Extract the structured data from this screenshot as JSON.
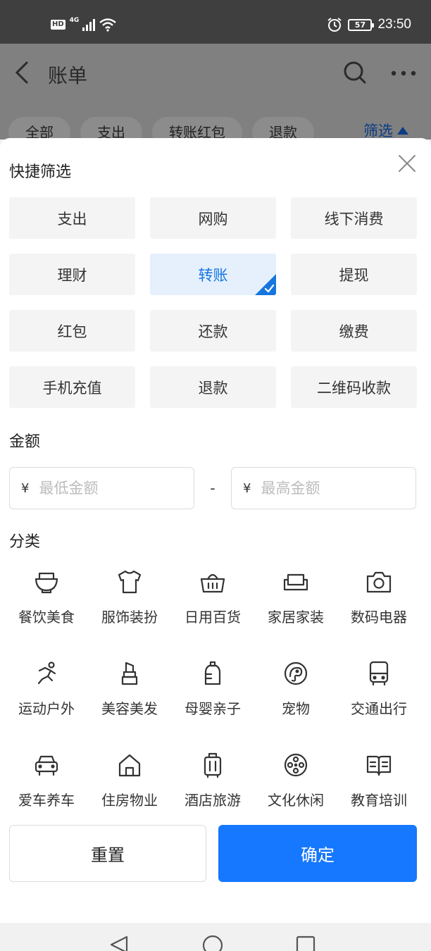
{
  "status_bar": {
    "hd": "HD",
    "network": "4G",
    "battery": "57",
    "time": "23:50"
  },
  "header": {
    "title": "账单",
    "tabs": [
      "全部",
      "支出",
      "转账红包",
      "退款"
    ],
    "filter_label": "筛选"
  },
  "filter_sheet": {
    "quick_title": "快捷筛选",
    "quick_chips": [
      {
        "label": "支出",
        "selected": false
      },
      {
        "label": "网购",
        "selected": false
      },
      {
        "label": "线下消费",
        "selected": false
      },
      {
        "label": "理财",
        "selected": false
      },
      {
        "label": "转账",
        "selected": true
      },
      {
        "label": "提现",
        "selected": false
      },
      {
        "label": "红包",
        "selected": false
      },
      {
        "label": "还款",
        "selected": false
      },
      {
        "label": "缴费",
        "selected": false
      },
      {
        "label": "手机充值",
        "selected": false
      },
      {
        "label": "退款",
        "selected": false
      },
      {
        "label": "二维码收款",
        "selected": false
      }
    ],
    "amount_title": "金额",
    "currency": "¥",
    "min_placeholder": "最低金额",
    "max_placeholder": "最高金额",
    "separator": "-",
    "category_title": "分类",
    "categories": [
      {
        "label": "餐饮美食",
        "icon": "bowl-icon"
      },
      {
        "label": "服饰装扮",
        "icon": "shirt-icon"
      },
      {
        "label": "日用百货",
        "icon": "basket-icon"
      },
      {
        "label": "家居家装",
        "icon": "sofa-icon"
      },
      {
        "label": "数码电器",
        "icon": "camera-icon"
      },
      {
        "label": "运动户外",
        "icon": "runner-icon"
      },
      {
        "label": "美容美发",
        "icon": "lipstick-icon"
      },
      {
        "label": "母婴亲子",
        "icon": "baby-bottle-icon"
      },
      {
        "label": "宠物",
        "icon": "pet-icon"
      },
      {
        "label": "交通出行",
        "icon": "bus-icon"
      },
      {
        "label": "爱车养车",
        "icon": "car-icon"
      },
      {
        "label": "住房物业",
        "icon": "house-icon"
      },
      {
        "label": "酒店旅游",
        "icon": "luggage-icon"
      },
      {
        "label": "文化休闲",
        "icon": "film-reel-icon"
      },
      {
        "label": "教育培训",
        "icon": "book-icon"
      }
    ],
    "reset_label": "重置",
    "confirm_label": "确定"
  },
  "colors": {
    "accent": "#1677ff",
    "selected_bg": "#e6f0fd",
    "chip_bg": "#f4f4f4",
    "overlay": "#808080"
  }
}
